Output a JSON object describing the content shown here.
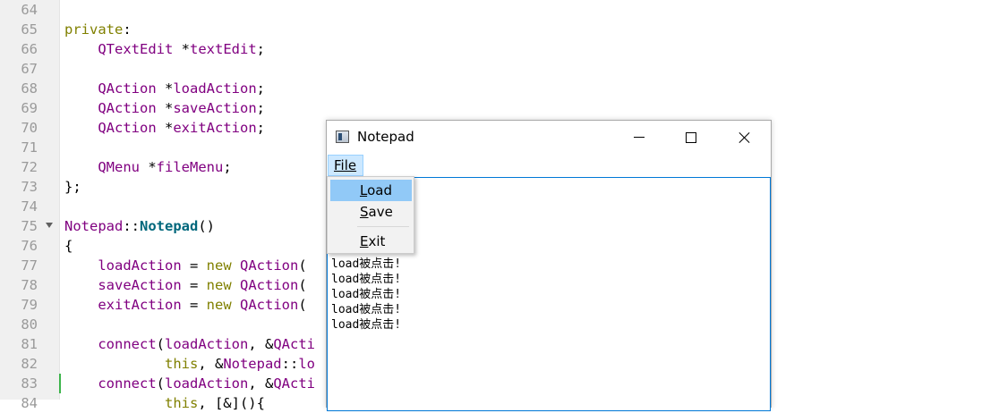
{
  "editor": {
    "lines": [
      {
        "n": "64",
        "tokens": []
      },
      {
        "n": "65",
        "tokens": [
          [
            "kw",
            "private"
          ],
          [
            "pl",
            ":"
          ]
        ]
      },
      {
        "n": "66",
        "tokens": [
          [
            "pl",
            "    "
          ],
          [
            "ty",
            "QTextEdit"
          ],
          [
            "pl",
            " *"
          ],
          [
            "cl",
            "textEdit"
          ],
          [
            "pl",
            ";"
          ]
        ]
      },
      {
        "n": "67",
        "tokens": []
      },
      {
        "n": "68",
        "tokens": [
          [
            "pl",
            "    "
          ],
          [
            "ty",
            "QAction"
          ],
          [
            "pl",
            " *"
          ],
          [
            "cl",
            "loadAction"
          ],
          [
            "pl",
            ";"
          ]
        ]
      },
      {
        "n": "69",
        "tokens": [
          [
            "pl",
            "    "
          ],
          [
            "ty",
            "QAction"
          ],
          [
            "pl",
            " *"
          ],
          [
            "cl",
            "saveAction"
          ],
          [
            "pl",
            ";"
          ]
        ]
      },
      {
        "n": "70",
        "tokens": [
          [
            "pl",
            "    "
          ],
          [
            "ty",
            "QAction"
          ],
          [
            "pl",
            " *"
          ],
          [
            "cl",
            "exitAction"
          ],
          [
            "pl",
            ";"
          ]
        ]
      },
      {
        "n": "71",
        "tokens": []
      },
      {
        "n": "72",
        "tokens": [
          [
            "pl",
            "    "
          ],
          [
            "ty",
            "QMenu"
          ],
          [
            "pl",
            " *"
          ],
          [
            "cl",
            "fileMenu"
          ],
          [
            "pl",
            ";"
          ]
        ]
      },
      {
        "n": "73",
        "tokens": [
          [
            "pl",
            "};"
          ]
        ]
      },
      {
        "n": "74",
        "tokens": []
      },
      {
        "n": "75",
        "fold": true,
        "tokens": [
          [
            "ty",
            "Notepad"
          ],
          [
            "pl",
            "::"
          ],
          [
            "fn",
            "Notepad"
          ],
          [
            "pl",
            "()"
          ]
        ]
      },
      {
        "n": "76",
        "tokens": [
          [
            "pl",
            "{"
          ]
        ]
      },
      {
        "n": "77",
        "tokens": [
          [
            "pl",
            "    "
          ],
          [
            "cl",
            "loadAction"
          ],
          [
            "pl",
            " = "
          ],
          [
            "kw",
            "new"
          ],
          [
            "pl",
            " "
          ],
          [
            "ty",
            "QAction"
          ],
          [
            "pl",
            "("
          ]
        ]
      },
      {
        "n": "78",
        "tokens": [
          [
            "pl",
            "    "
          ],
          [
            "cl",
            "saveAction"
          ],
          [
            "pl",
            " = "
          ],
          [
            "kw",
            "new"
          ],
          [
            "pl",
            " "
          ],
          [
            "ty",
            "QAction"
          ],
          [
            "pl",
            "("
          ]
        ]
      },
      {
        "n": "79",
        "tokens": [
          [
            "pl",
            "    "
          ],
          [
            "cl",
            "exitAction"
          ],
          [
            "pl",
            " = "
          ],
          [
            "kw",
            "new"
          ],
          [
            "pl",
            " "
          ],
          [
            "ty",
            "QAction"
          ],
          [
            "pl",
            "("
          ]
        ]
      },
      {
        "n": "80",
        "tokens": []
      },
      {
        "n": "81",
        "tokens": [
          [
            "pl",
            "    "
          ],
          [
            "ty",
            "connect"
          ],
          [
            "pl",
            "("
          ],
          [
            "cl",
            "loadAction"
          ],
          [
            "pl",
            ", &"
          ],
          [
            "ty",
            "QActi"
          ]
        ]
      },
      {
        "n": "82",
        "tokens": [
          [
            "pl",
            "            "
          ],
          [
            "kw",
            "this"
          ],
          [
            "pl",
            ", &"
          ],
          [
            "ty",
            "Notepad"
          ],
          [
            "pl",
            "::"
          ],
          [
            "ty",
            "lo"
          ]
        ]
      },
      {
        "n": "83",
        "change": true,
        "tokens": [
          [
            "pl",
            "    "
          ],
          [
            "ty",
            "connect"
          ],
          [
            "pl",
            "("
          ],
          [
            "cl",
            "loadAction"
          ],
          [
            "pl",
            ", &"
          ],
          [
            "ty",
            "QActi"
          ]
        ]
      },
      {
        "n": "84",
        "tokens": [
          [
            "pl",
            "            "
          ],
          [
            "kw",
            "this"
          ],
          [
            "pl",
            ", [&](){"
          ]
        ]
      }
    ]
  },
  "window": {
    "title": "Notepad",
    "menu_file": "File",
    "output_lines": [
      "load被点击!",
      "load被点击!",
      "load被点击!",
      "load被点击!",
      "load被点击!"
    ]
  },
  "file_menu": {
    "items": [
      {
        "label": "Load",
        "mnemonic": "L",
        "rest": "oad"
      },
      {
        "label": "Save",
        "mnemonic": "S",
        "rest": "ave"
      },
      {
        "label": "Exit",
        "mnemonic": "E",
        "rest": "xit"
      }
    ]
  }
}
